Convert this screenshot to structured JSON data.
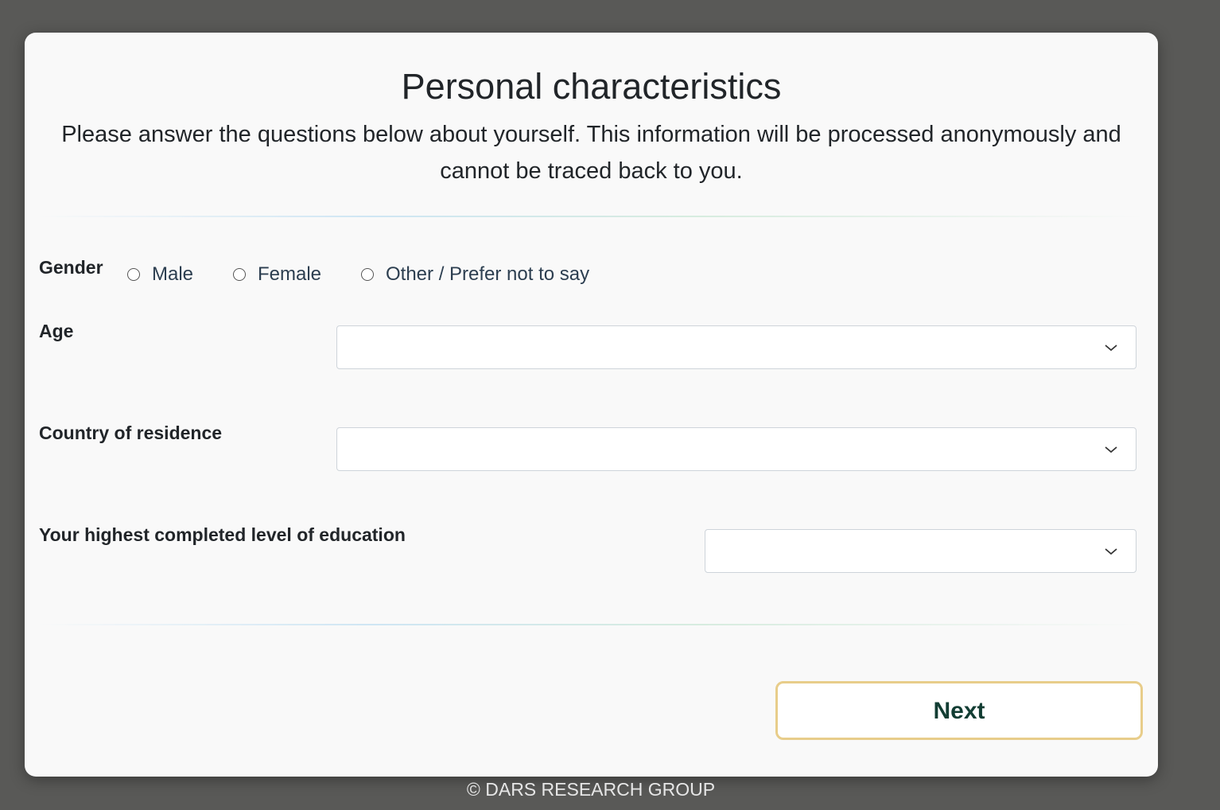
{
  "page": {
    "title": "Personal characteristics",
    "intro": "Please answer the questions below about yourself. This information will be processed anonymously and cannot be traced back to you."
  },
  "gender": {
    "label": "Gender",
    "options": [
      "Male",
      "Female",
      "Other / Prefer not to say"
    ],
    "selected": ""
  },
  "age": {
    "label": "Age",
    "value": ""
  },
  "country": {
    "label": "Country of residence",
    "value": ""
  },
  "education": {
    "label": "Your highest completed level of education",
    "value": ""
  },
  "actions": {
    "next_label": "Next"
  },
  "footer": {
    "text": "© DARS RESEARCH GROUP"
  },
  "colors": {
    "background": "#595957",
    "card": "#f9f9f9",
    "next_border": "#e8cd8a",
    "next_text": "#123d33"
  }
}
